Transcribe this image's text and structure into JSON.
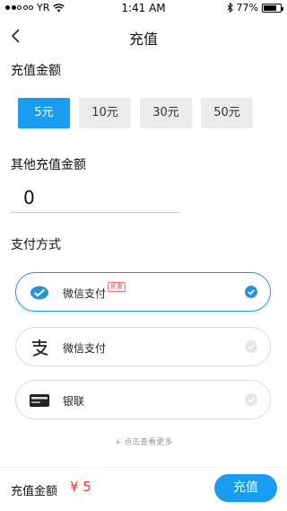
{
  "status_bar": {
    "carrier": "YR",
    "time": "1:41 AM",
    "battery": "77%",
    "battery_level": 0.77
  },
  "header": {
    "title": "充值"
  },
  "amount_section": {
    "title": "充值金额",
    "options": [
      "5元",
      "10元",
      "30元",
      "50元"
    ],
    "selected_index": 0
  },
  "other_amount": {
    "title": "其他充值金额",
    "value": "0"
  },
  "payment": {
    "title": "支付方式",
    "options": [
      {
        "label": "微信支付",
        "badge": "优惠",
        "icon": "wechat-pay-icon",
        "selected": true
      },
      {
        "label": "微信支付",
        "icon": "alipay-icon",
        "selected": false
      },
      {
        "label": "银联",
        "icon": "unionpay-icon",
        "selected": false
      }
    ],
    "more": "+ 点击查看更多"
  },
  "footer": {
    "total_label": "充值金额",
    "total_value": "¥ 5",
    "submit": "充值"
  },
  "colors": {
    "accent": "#1a9df0",
    "price": "#ff3333"
  }
}
